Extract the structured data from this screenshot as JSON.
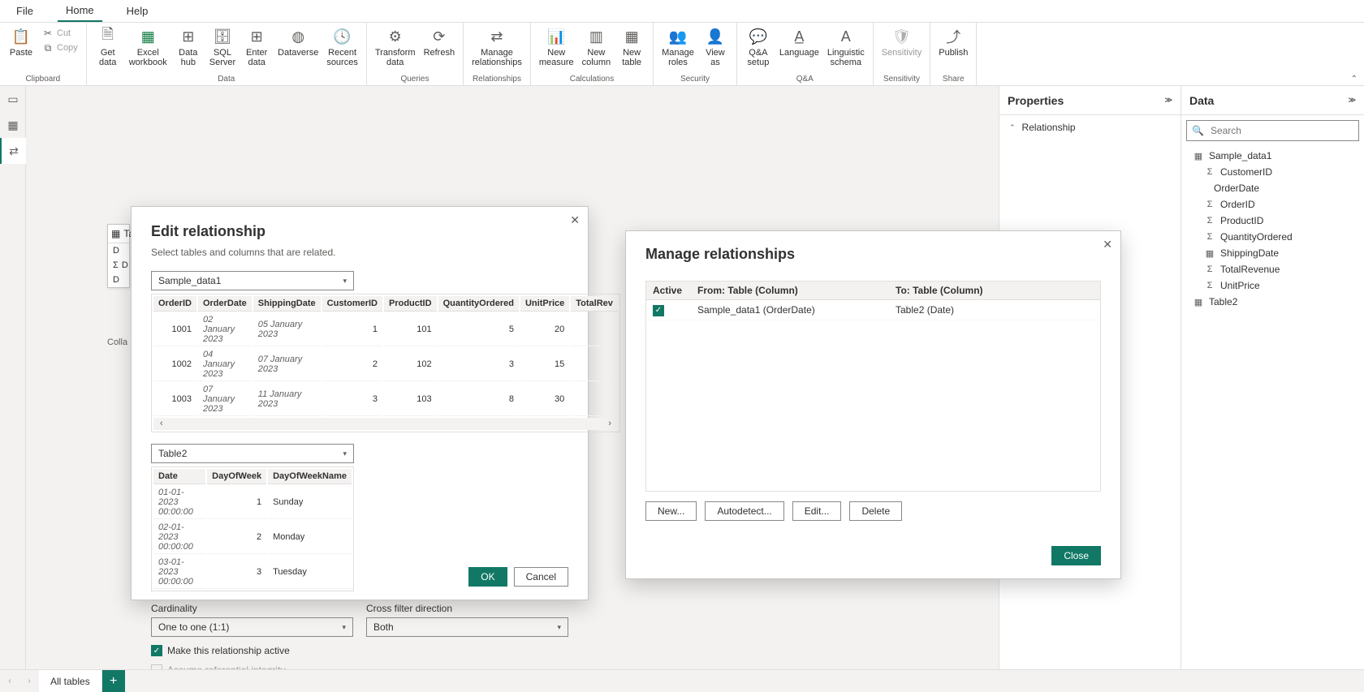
{
  "menu": {
    "file": "File",
    "home": "Home",
    "help": "Help"
  },
  "ribbon": {
    "clipboard": {
      "paste": "Paste",
      "cut": "Cut",
      "copy": "Copy",
      "label": "Clipboard"
    },
    "data": {
      "get": "Get\ndata",
      "excel": "Excel\nworkbook",
      "datahub": "Data\nhub",
      "sql": "SQL\nServer",
      "enter": "Enter\ndata",
      "dataverse": "Dataverse",
      "recent": "Recent\nsources",
      "label": "Data"
    },
    "queries": {
      "transform": "Transform\ndata",
      "refresh": "Refresh",
      "label": "Queries"
    },
    "relationships": {
      "manage": "Manage\nrelationships",
      "label": "Relationships"
    },
    "calculations": {
      "measure": "New\nmeasure",
      "column": "New\ncolumn",
      "table": "New\ntable",
      "label": "Calculations"
    },
    "security": {
      "roles": "Manage\nroles",
      "view": "View\nas",
      "label": "Security"
    },
    "qa": {
      "setup": "Q&A\nsetup",
      "language": "Language",
      "schema": "Linguistic\nschema",
      "label": "Q&A"
    },
    "sensitivity": {
      "btn": "Sensitivity",
      "label": "Sensitivity"
    },
    "share": {
      "publish": "Publish",
      "label": "Share"
    }
  },
  "properties": {
    "title": "Properties",
    "section": "Relationship"
  },
  "dataPane": {
    "title": "Data",
    "searchPlaceholder": "Search",
    "sample": "Sample_data1",
    "fields1": [
      "CustomerID",
      "OrderDate",
      "OrderID",
      "ProductID",
      "QuantityOrdered",
      "ShippingDate",
      "TotalRevenue",
      "UnitPrice"
    ],
    "table2": "Table2"
  },
  "editDialog": {
    "title": "Edit relationship",
    "subtitle": "Select tables and columns that are related.",
    "table1Name": "Sample_data1",
    "t1Headers": [
      "OrderID",
      "OrderDate",
      "ShippingDate",
      "CustomerID",
      "ProductID",
      "QuantityOrdered",
      "UnitPrice",
      "TotalRev"
    ],
    "t1Rows": [
      [
        "1001",
        "02 January 2023",
        "05 January 2023",
        "1",
        "101",
        "5",
        "20"
      ],
      [
        "1002",
        "04 January 2023",
        "07 January 2023",
        "2",
        "102",
        "3",
        "15"
      ],
      [
        "1003",
        "07 January 2023",
        "11 January 2023",
        "3",
        "103",
        "8",
        "30"
      ]
    ],
    "table2Name": "Table2",
    "t2Headers": [
      "Date",
      "DayOfWeek",
      "DayOfWeekName"
    ],
    "t2Rows": [
      [
        "01-01-2023 00:00:00",
        "1",
        "Sunday"
      ],
      [
        "02-01-2023 00:00:00",
        "2",
        "Monday"
      ],
      [
        "03-01-2023 00:00:00",
        "3",
        "Tuesday"
      ]
    ],
    "cardinalityLabel": "Cardinality",
    "cardinalityValue": "One to one (1:1)",
    "crossFilterLabel": "Cross filter direction",
    "crossFilterValue": "Both",
    "chkActive": "Make this relationship active",
    "chkRef": "Assume referential integrity",
    "ok": "OK",
    "cancel": "Cancel"
  },
  "manageDialog": {
    "title": "Manage relationships",
    "colActive": "Active",
    "colFrom": "From: Table (Column)",
    "colTo": "To: Table (Column)",
    "rowFrom": "Sample_data1 (OrderDate)",
    "rowTo": "Table2 (Date)",
    "new": "New...",
    "auto": "Autodetect...",
    "edit": "Edit...",
    "delete": "Delete",
    "close": "Close"
  },
  "tabBar": {
    "all": "All tables"
  },
  "behind": {
    "collapse": "Colla",
    "ta": "Ta",
    "d1": "D",
    "d2": "D",
    "d3": "D"
  }
}
